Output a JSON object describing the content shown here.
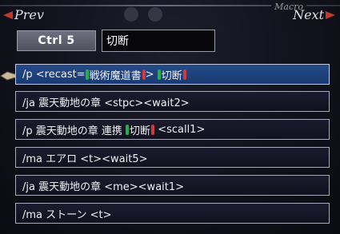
{
  "header": {
    "frame_title": "Macro",
    "prev_label": "Prev",
    "next_label": "Next"
  },
  "macro_set": {
    "label": "Ctrl 5",
    "name": "切断"
  },
  "lines": [
    {
      "selected": true,
      "parts": [
        {
          "type": "text",
          "text": "/p <recast="
        },
        {
          "type": "autotrans",
          "text": "戦術魔道書"
        },
        {
          "type": "text",
          "text": "> "
        },
        {
          "type": "autotrans",
          "text": "切断"
        }
      ]
    },
    {
      "selected": false,
      "parts": [
        {
          "type": "text",
          "text": "/ja 震天動地の章 <stpc><wait2>"
        }
      ]
    },
    {
      "selected": false,
      "parts": [
        {
          "type": "text",
          "text": "/p 震天動地の章 連携 "
        },
        {
          "type": "autotrans",
          "text": "切断"
        },
        {
          "type": "text",
          "text": " <scall1>"
        }
      ]
    },
    {
      "selected": false,
      "parts": [
        {
          "type": "text",
          "text": "/ma エアロ <t><wait5>"
        }
      ]
    },
    {
      "selected": false,
      "parts": [
        {
          "type": "text",
          "text": "/ja 震天動地の章 <me><wait1>"
        }
      ]
    },
    {
      "selected": false,
      "parts": [
        {
          "type": "text",
          "text": "/ma ストーン <t>"
        }
      ]
    }
  ],
  "colors": {
    "arrow": "#c0392b",
    "selected_row": "#244a86",
    "autotrans_open": "#22b14c",
    "autotrans_close": "#d23a3a"
  },
  "icons": {
    "prev": "left-arrow-icon",
    "next": "right-arrow-icon",
    "pointer": "hand-pointer-icon"
  }
}
